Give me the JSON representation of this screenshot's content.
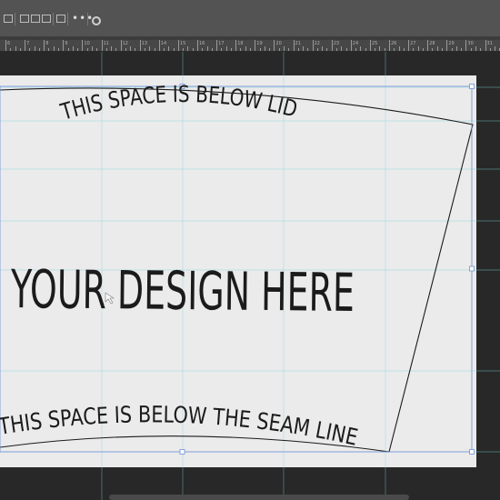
{
  "ruler": {
    "labels": [
      "6",
      "7",
      "8",
      "9",
      "10",
      "11",
      "12",
      "13",
      "14",
      "15",
      "16",
      "17",
      "18",
      "19",
      "20",
      "21",
      "22",
      "23",
      "24",
      "25",
      "26",
      "27",
      "28",
      "29",
      "30",
      "31"
    ]
  },
  "artboard": {
    "top_text": "THIS SPACE IS BELOW LID",
    "main_text": "YOUR DESIGN HERE",
    "bottom_text": "THIS SPACE IS BELOW THE SEAM LINE"
  },
  "colors": {
    "ui_bar": "#535353",
    "pasteboard": "#282828",
    "artboard": "#ebebeb",
    "guide": "#7fd6dc",
    "selection": "#6f8fd8",
    "text": "#1b1b1b"
  },
  "icons": [
    "align-left-icon",
    "align-center-icon",
    "align-right-icon",
    "distribute-icon",
    "more-options-icon",
    "settings-icon"
  ]
}
